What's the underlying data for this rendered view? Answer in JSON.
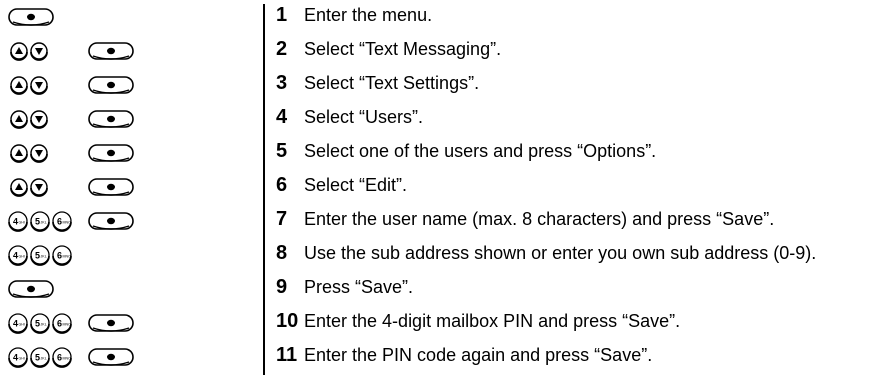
{
  "steps": [
    {
      "number": "1",
      "text": "Enter the menu.",
      "keys": [
        "select-key"
      ]
    },
    {
      "number": "2",
      "text": "Select “Text Messaging”.",
      "keys": [
        "nav-keys",
        "select-key"
      ]
    },
    {
      "number": "3",
      "text": "Select “Text Settings”.",
      "keys": [
        "nav-keys",
        "select-key"
      ]
    },
    {
      "number": "4",
      "text": "Select “Users”.",
      "keys": [
        "nav-keys",
        "select-key"
      ]
    },
    {
      "number": "5",
      "text": "Select one of the users and press “Options”.",
      "keys": [
        "nav-keys",
        "select-key"
      ]
    },
    {
      "number": "6",
      "text": "Select “Edit”.",
      "keys": [
        "nav-keys",
        "select-key"
      ]
    },
    {
      "number": "7",
      "text": "Enter the user name (max. 8 characters) and press “Save”.",
      "keys": [
        "digit-keys",
        "select-key"
      ]
    },
    {
      "number": "8",
      "text": "Use the sub address shown or enter you own sub address (0-9).",
      "keys": [
        "digit-keys"
      ]
    },
    {
      "number": "9",
      "text": "Press “Save”.",
      "keys": [
        "select-key"
      ]
    },
    {
      "number": "10",
      "text": "Enter the 4-digit mailbox PIN and press “Save”.",
      "keys": [
        "digit-keys",
        "select-key"
      ]
    },
    {
      "number": "11",
      "text": "Enter the PIN code again and press “Save”.",
      "keys": [
        "digit-keys",
        "select-key"
      ]
    }
  ],
  "digit_key_labels": [
    "4GHI",
    "5JKL",
    "6MNO"
  ]
}
